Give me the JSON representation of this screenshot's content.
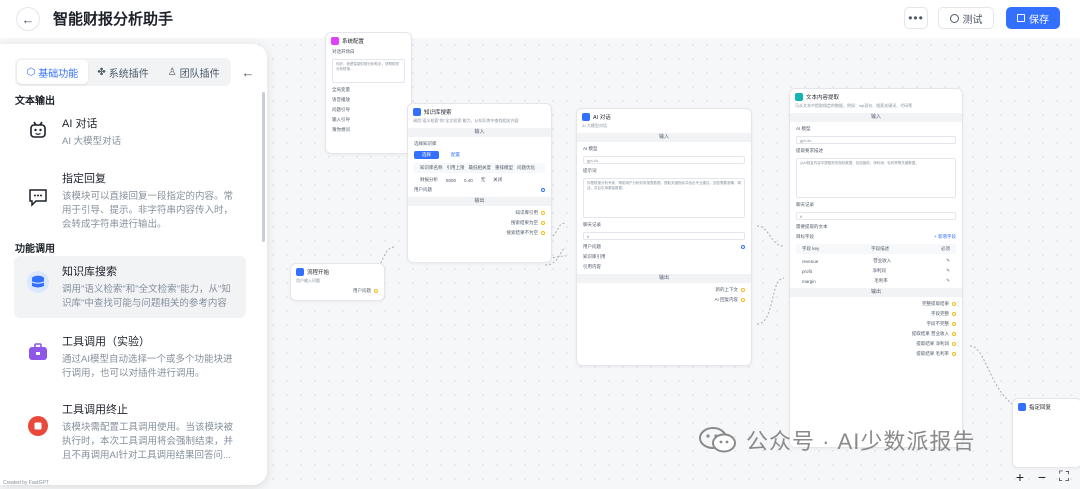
{
  "header": {
    "title": "智能财报分析助手",
    "test_label": "测试",
    "save_label": "保存",
    "more_label": "•••"
  },
  "sidebar": {
    "tabs": [
      {
        "label": "基础功能",
        "icon": "cube-icon",
        "active": true
      },
      {
        "label": "系统插件",
        "icon": "puzzle-icon",
        "active": false
      },
      {
        "label": "团队插件",
        "icon": "user-icon",
        "active": false
      }
    ],
    "sections": [
      {
        "heading": "文本输出"
      },
      {
        "heading": "功能调用"
      }
    ],
    "items": [
      {
        "title": "AI 对话",
        "desc": "AI 大模型对话",
        "icon": "robot-icon"
      },
      {
        "title": "指定回复",
        "desc": "该模块可以直接回复一段指定的内容。常用于引导、提示。非字符串内容传入时，会转成字符串进行输出。",
        "icon": "chat-bubble-icon"
      },
      {
        "title": "知识库搜索",
        "desc": "调用\"语义检索\"和\"全文检索\"能力，从\"知识库\"中查找可能与问题相关的参考内容",
        "icon": "database-icon"
      },
      {
        "title": "工具调用（实验）",
        "desc": "通过AI模型自动选择一个或多个功能块进行调用，也可以对插件进行调用。",
        "icon": "toolbox-icon"
      },
      {
        "title": "工具调用终止",
        "desc": "该模块需配置工具调用使用。当该模块被执行时，本次工具调用将会强制结束，并且不再调用AI针对工具调用结果回答问...",
        "icon": "stop-icon"
      }
    ]
  },
  "nodes": {
    "n1": {
      "title": "系统配置",
      "lines": [
        "对话开场白",
        "你好，我是智能财报分析助手，请帮助您分析财报...",
        "全局变量",
        "语音播放",
        "问题引导",
        "输入引导",
        "猜你想问"
      ]
    },
    "n2": {
      "title": "知识库搜索",
      "desc": "调用\"语义检索\"和\"全文检索\"能力，从知识库中查找相关内容",
      "search_label": "选择知识库",
      "band_in": "输入",
      "band_out": "输出",
      "btn1": "选择",
      "btn2": "配置",
      "table_head": [
        "知识库名称",
        "引用上限",
        "最低相关度",
        "重排模型",
        "问题优化"
      ],
      "table_row": [
        "财报分析",
        "5000",
        "0.40",
        "无",
        "关闭"
      ],
      "row_user_q": "用户问题",
      "out1": "知识库引用",
      "out2": "搜索结果为空",
      "out3": "搜索结果不为空"
    },
    "n3": {
      "title": "AI 对话",
      "desc": "AI 大模型对话",
      "band_in": "输入",
      "band_out": "输出",
      "model_label": "AI 模型",
      "model_value": "gpt-4o",
      "prompt_label": "提示词",
      "prompt_text": "你是财报分析专家，帮助用户分析财务报表数据，提取关键指标并给出专业建议。回答需要准确、简洁，并且引用原始数据。",
      "history_label": "聊天记录",
      "history_value": "6",
      "user_q": "用户问题",
      "quote_label": "知识库引用",
      "quote_value": "引用内容",
      "out1": "AI 回复内容",
      "out2": "新的上下文"
    },
    "n4": {
      "title": "文本内容提取",
      "desc": "可从文本中提取指定的数据，例如：sql语句、搜索关键词、代码等",
      "band_in": "输入",
      "band_out": "输出",
      "model_label": "AI 模型",
      "model_value": "gpt-4o",
      "req_label": "提取要求描述",
      "req_text": "从AI回复内容中提取财务指标数据，包括营收、净利润、毛利率等关键数据。",
      "history_label": "聊天记录",
      "text_label": "需要提取的文本",
      "fields_label": "目标字段",
      "add_field": "+ 新增字段",
      "field_head": [
        "字段 key",
        "字段描述",
        "必须"
      ],
      "fields": [
        [
          "revenue",
          "营业收入"
        ],
        [
          "profit",
          "净利润"
        ],
        [
          "margin",
          "毛利率"
        ]
      ],
      "outs": [
        "完整提取结果",
        "字段完整",
        "字段不完整",
        "提取结果 营业收入",
        "提取结果 净利润",
        "提取结果 毛利率"
      ]
    },
    "n5": {
      "title": "流程开始",
      "desc": "用户输入问题",
      "out": "用户问题"
    },
    "n6": {
      "title": "指定回复"
    }
  },
  "watermark": {
    "text": "公众号 · AI少数派报告"
  },
  "zoom": {
    "in": "+",
    "out": "−",
    "fit": "⛶"
  },
  "footnote": "Created by FastGPT"
}
